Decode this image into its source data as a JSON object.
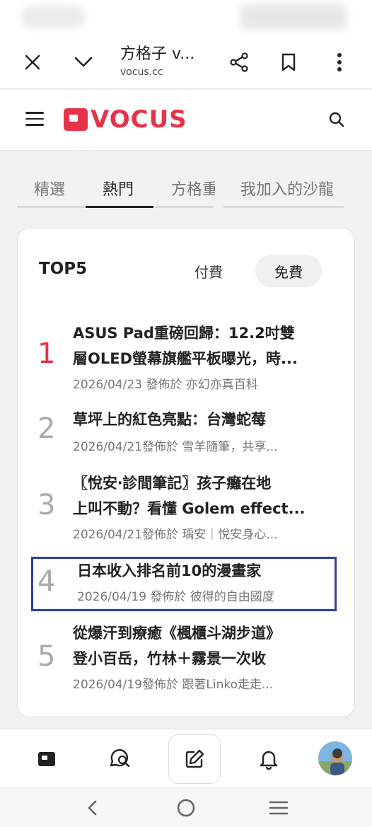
{
  "browser": {
    "tab_title": "方格子 v...",
    "url": "vocus.cc"
  },
  "site": {
    "logo_text": "VOCUS",
    "brand_color": "#e5334a"
  },
  "tabs": [
    {
      "label": "精選",
      "active": false
    },
    {
      "label": "熱門",
      "active": true
    },
    {
      "label": "方格重",
      "active": false
    },
    {
      "label": "我加入的沙龍",
      "active": false
    }
  ],
  "ranking": {
    "title": "TOP5",
    "filter_paid": "付費",
    "filter_free": "免費",
    "items": [
      {
        "rank": "1",
        "title_line1": "ASUS Pad重磅回歸：12.2吋雙",
        "title_line2": "層OLED螢幕旗艦平板曝光，時...",
        "meta": "2026/04/23 發佈於 亦幻亦真百科"
      },
      {
        "rank": "2",
        "title_line1": "草坪上的紅色亮點：台灣蛇莓",
        "meta": "2026/04/21發佈於 雪羊隨筆，共享..."
      },
      {
        "rank": "3",
        "title_line1": "〖悅安‧診間筆記〗孩子癱在地",
        "title_line2": "上叫不動？看懂 Golem effect...",
        "meta": "2026/04/21發佈於 瑀安｜悅安身心..."
      },
      {
        "rank": "4",
        "title_line1": "日本收入排名前10的漫畫家",
        "meta": "2026/04/19 發佈於 彼得的自由國度"
      },
      {
        "rank": "5",
        "title_line1": "從爆汗到療癒《楓櫃斗湖步道》",
        "title_line2": "登小百岳，竹林＋霧景一次收",
        "meta": "2026/04/19發佈於 跟著Linko走走..."
      }
    ]
  },
  "highlight_color": "#2f3fa4"
}
